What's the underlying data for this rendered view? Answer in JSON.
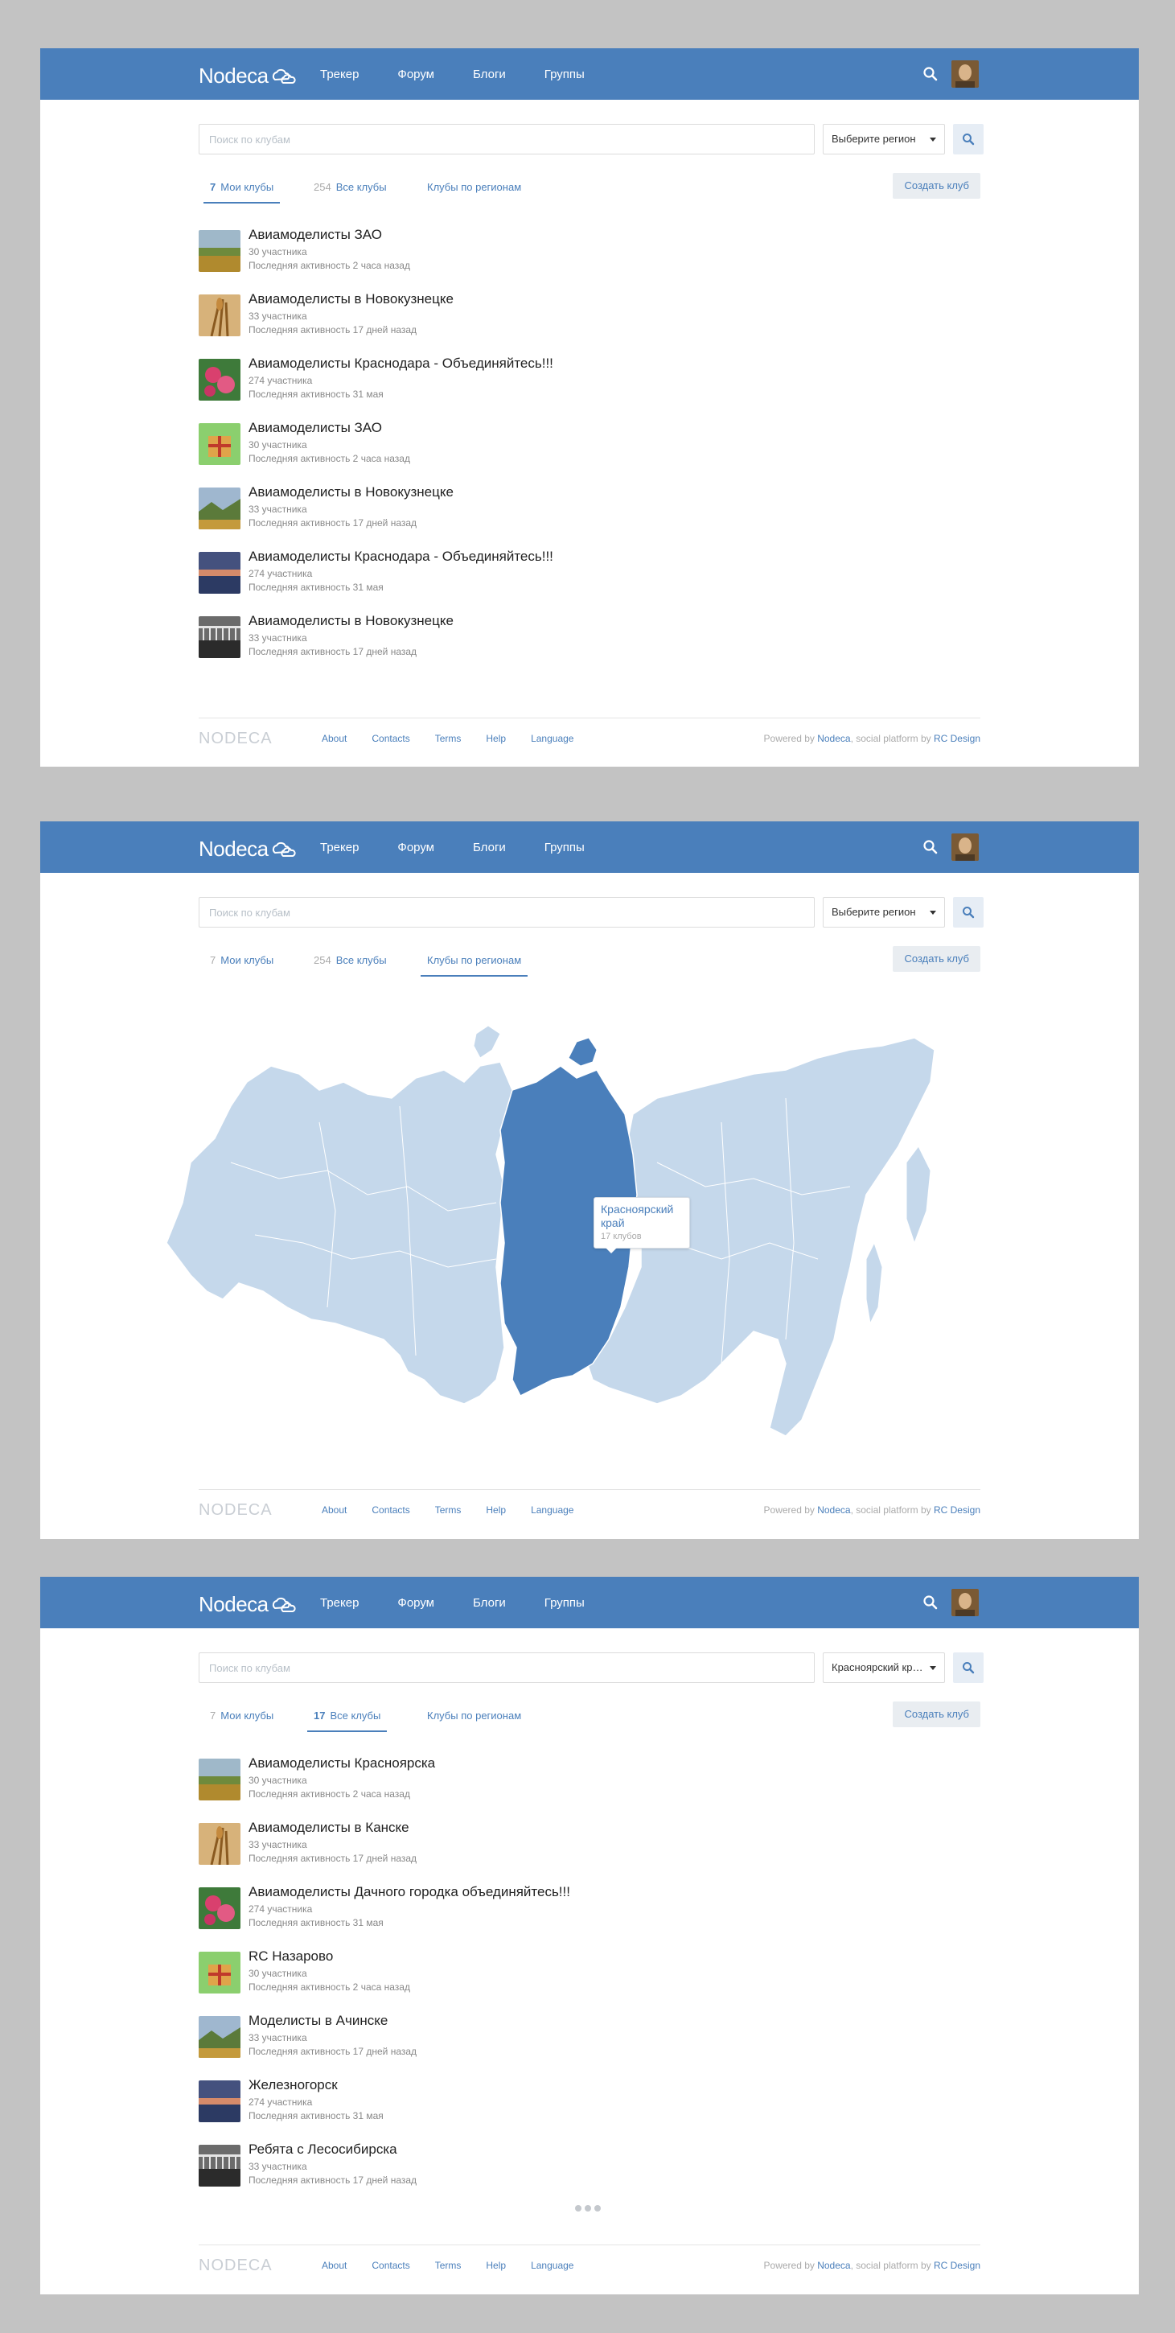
{
  "topbar": {
    "logo_text": "Nodeca",
    "nav": [
      "Трекер",
      "Форум",
      "Блоги",
      "Группы"
    ]
  },
  "search": {
    "placeholder": "Поиск по клубам"
  },
  "tabs": {
    "my_count": "7",
    "my_label": "Мои клубы",
    "all_count_default": "254",
    "all_count_region": "17",
    "all_label": "Все клубы",
    "regions_label": "Клубы по регионам"
  },
  "create_button": "Создать клуб",
  "screen1": {
    "region": "Выберите регион",
    "clubs": [
      {
        "name": "Авиамоделисты ЗАО",
        "members": "30 участника",
        "activity": "Последняя активность 2 часа назад",
        "thumb": "field"
      },
      {
        "name": "Авиамоделисты в Новокузнецке",
        "members": "33 участника",
        "activity": "Последняя активность 17 дней назад",
        "thumb": "wheat"
      },
      {
        "name": "Авиамоделисты Краснодара - Объединяйтесь!!!",
        "members": "274 участника",
        "activity": "Последняя активность 31 мая",
        "thumb": "flower"
      },
      {
        "name": "Авиамоделисты ЗАО",
        "members": "30 участника",
        "activity": "Последняя активность 2 часа назад",
        "thumb": "gift"
      },
      {
        "name": "Авиамоделисты в Новокузнецке",
        "members": "33 участника",
        "activity": "Последняя активность 17 дней назад",
        "thumb": "hills"
      },
      {
        "name": "Авиамоделисты Краснодара - Объединяйтесь!!!",
        "members": "274 участника",
        "activity": "Последняя активность 31 мая",
        "thumb": "sunset"
      },
      {
        "name": "Авиамоделисты в Новокузнецке",
        "members": "33 участника",
        "activity": "Последняя активность 17 дней назад",
        "thumb": "pier"
      }
    ]
  },
  "screen2": {
    "region": "Выберите регион",
    "tooltip": {
      "name": "Красноярский край",
      "count": "17 клубов"
    }
  },
  "screen3": {
    "region": "Красноярский край",
    "clubs": [
      {
        "name": "Авиамоделисты Красноярска",
        "members": "30 участника",
        "activity": "Последняя активность 2 часа назад",
        "thumb": "field"
      },
      {
        "name": "Авиамоделисты в Канске",
        "members": "33 участника",
        "activity": "Последняя активность 17 дней назад",
        "thumb": "wheat"
      },
      {
        "name": "Авиамоделисты Дачного городка объединяйтесь!!!",
        "members": "274 участника",
        "activity": "Последняя активность 31 мая",
        "thumb": "flower"
      },
      {
        "name": "RC Назарово",
        "members": "30 участника",
        "activity": "Последняя активность 2 часа назад",
        "thumb": "gift"
      },
      {
        "name": "Моделисты в Ачинске",
        "members": "33 участника",
        "activity": "Последняя активность 17 дней назад",
        "thumb": "hills"
      },
      {
        "name": "Железногорск",
        "members": "274 участника",
        "activity": "Последняя активность 31 мая",
        "thumb": "sunset"
      },
      {
        "name": "Ребята с Лесосибирска",
        "members": "33 участника",
        "activity": "Последняя активность 17 дней назад",
        "thumb": "pier"
      }
    ]
  },
  "footer": {
    "logo": "NODECA",
    "links": [
      "About",
      "Contacts",
      "Terms",
      "Help",
      "Language"
    ],
    "powered_prefix": "Powered by ",
    "powered_nodeca": "Nodeca",
    "powered_mid": ", social platform by ",
    "powered_rc": "RC Design"
  },
  "colors": {
    "brand": "#4a7fbb",
    "map_region": "#c5d8eb",
    "map_selected": "#4a7fbb"
  }
}
